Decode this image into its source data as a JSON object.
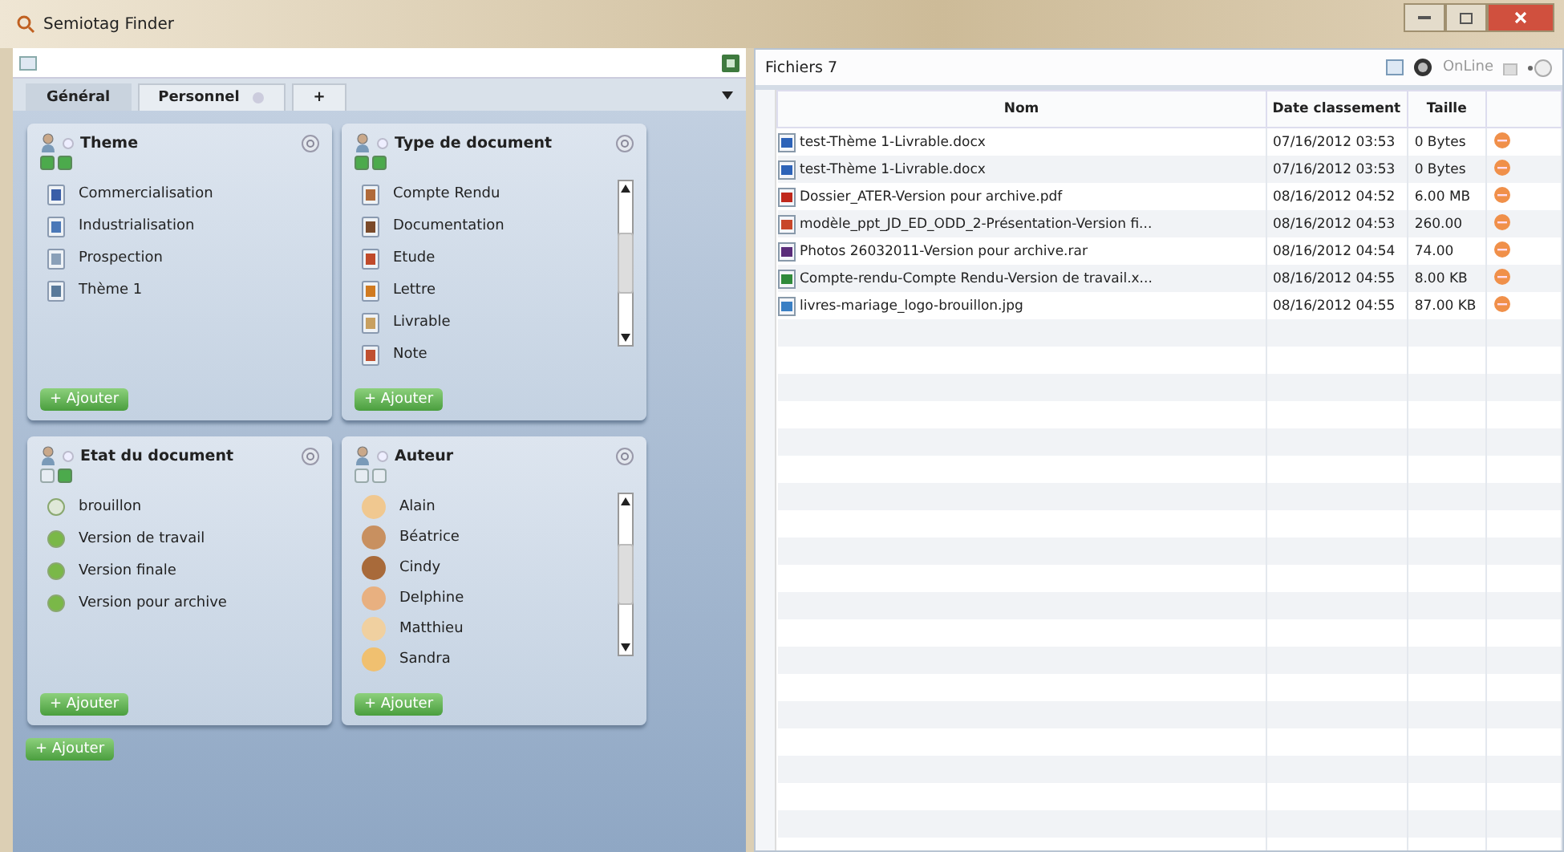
{
  "window": {
    "title": "Semiotag Finder"
  },
  "tabs": [
    {
      "label": "Général",
      "selected": true,
      "closable": false
    },
    {
      "label": "Personnel",
      "selected": false,
      "closable": true
    },
    {
      "label": "+",
      "selected": false,
      "closable": false
    }
  ],
  "cards": [
    {
      "title": "Theme",
      "kind": "document",
      "scrollable": false,
      "badges": [
        {
          "on": true
        },
        {
          "on": true
        }
      ],
      "items": [
        "Commercialisation",
        "Industrialisation",
        "Prospection",
        "Thème 1"
      ],
      "add_label": "+ Ajouter"
    },
    {
      "title": "Type de document",
      "kind": "document",
      "scrollable": true,
      "badges": [
        {
          "on": true
        },
        {
          "on": true
        }
      ],
      "items": [
        "Compte Rendu",
        "Documentation",
        "Etude",
        "Lettre",
        "Livrable",
        "Note"
      ],
      "add_label": "+ Ajouter"
    },
    {
      "title": "Etat du document",
      "kind": "status",
      "scrollable": false,
      "badges": [
        {
          "on": false
        },
        {
          "on": true
        }
      ],
      "items": [
        "brouillon",
        "Version de travail",
        "Version finale",
        "Version pour archive"
      ],
      "add_label": "+ Ajouter"
    },
    {
      "title": "Auteur",
      "kind": "person",
      "scrollable": true,
      "badges": [
        {
          "on": false
        },
        {
          "on": false
        }
      ],
      "items": [
        "Alain",
        "Béatrice",
        "Cindy",
        "Delphine",
        "Matthieu",
        "Sandra"
      ],
      "add_label": "+ Ajouter"
    }
  ],
  "add_label": "+ Ajouter",
  "files": {
    "title": "Fichiers 7",
    "online_label": "OnLine",
    "columns": [
      "Nom",
      "Date classement",
      "Taille"
    ],
    "rows": [
      {
        "kind": "word",
        "name": "test-Thème 1-Livrable.docx",
        "date": "07/16/2012 03:53",
        "size": "0 Bytes"
      },
      {
        "kind": "word",
        "name": "test-Thème 1-Livrable.docx",
        "date": "07/16/2012 03:53",
        "size": "0 Bytes"
      },
      {
        "kind": "pdf",
        "name": "Dossier_ATER-Version pour archive.pdf",
        "date": "08/16/2012 04:52",
        "size": "6.00 MB"
      },
      {
        "kind": "slides",
        "name": "modèle_ppt_JD_ED_ODD_2-Présentation-Version fi...",
        "date": "08/16/2012 04:53",
        "size": "260.00"
      },
      {
        "kind": "archive",
        "name": "Photos 26032011-Version pour archive.rar",
        "date": "08/16/2012 04:54",
        "size": "74.00"
      },
      {
        "kind": "sheet",
        "name": "Compte-rendu-Compte Rendu-Version de travail.x...",
        "date": "08/16/2012 04:55",
        "size": "8.00 KB"
      },
      {
        "kind": "image",
        "name": "livres-mariage_logo-brouillon.jpg",
        "date": "08/16/2012 04:55",
        "size": "87.00 KB"
      }
    ]
  }
}
